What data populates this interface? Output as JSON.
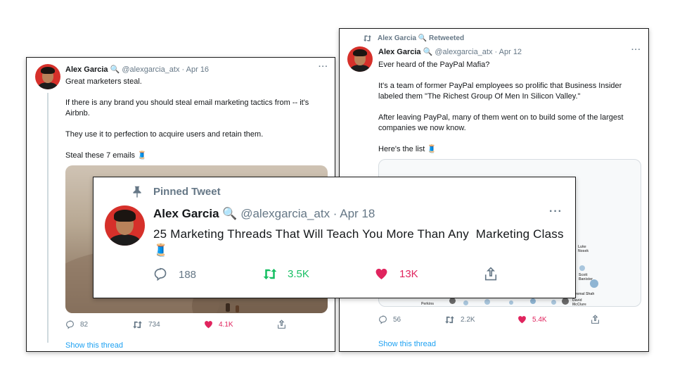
{
  "left_tweet": {
    "author_name": "Alex Garcia",
    "author_emoji": "🔍",
    "handle_date": "@alexgarcia_atx · Apr 16",
    "more": "···",
    "text": "Great marketers steal.\n\nIf there is any brand you should steal email marketing tactics from -- it's Airbnb.\n\nThey use it to perfection to acquire users and retain them.\n\nSteal these 7 emails 🧵",
    "replies": "82",
    "retweets": "734",
    "likes": "4.1K",
    "show_thread": "Show this thread"
  },
  "right_tweet": {
    "retweeted_by": "Alex Garcia 🔍 Retweeted",
    "author_name": "Alex Garcia",
    "author_emoji": "🔍",
    "handle_date": "@alexgarcia_atx · Apr 12",
    "more": "···",
    "text": "Ever heard of the PayPal Mafia?\n\nIt's a team of former PayPal employees so prolific that Business Insider labeled them \"The Richest Group Of Men In Silicon Valley.\"\n\nAfter leaving PayPal, many of them went on to build some of the largest companies we now know.\n\nHere's the list 🧵",
    "map_labels": [
      "Luke Nosek",
      "Scott Banister",
      "Premal Shah",
      "Perkins",
      "David McClure"
    ],
    "replies": "56",
    "retweets": "2.2K",
    "likes": "5.4K",
    "show_thread": "Show this thread"
  },
  "pinned_tweet": {
    "pinned_label": "Pinned Tweet",
    "author_name": "Alex Garcia",
    "author_emoji": "🔍",
    "handle_date": "@alexgarcia_atx · Apr 18",
    "more": "···",
    "text": "25 Marketing Threads That Will Teach You More Than Any  Marketing Class 🧵",
    "replies": "188",
    "retweets": "3.5K",
    "likes": "13K"
  },
  "colors": {
    "retweet_green": "#17bf63",
    "like_red": "#e0245e",
    "link_blue": "#1da1f2",
    "muted_gray": "#657786"
  }
}
